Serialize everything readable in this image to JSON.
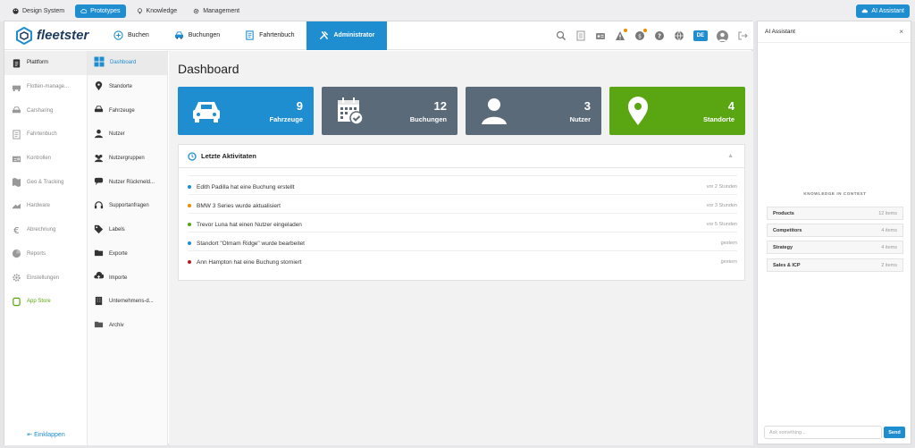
{
  "topbar": {
    "tabs": [
      {
        "label": "Design System",
        "icon": "palette-icon"
      },
      {
        "label": "Prototypes",
        "icon": "cloud-icon"
      },
      {
        "label": "Knowledge",
        "icon": "bulb-icon"
      },
      {
        "label": "Management",
        "icon": "gear-icon"
      }
    ],
    "ai_button": "AI Assistant"
  },
  "header": {
    "logo": "fleetster",
    "nav": [
      {
        "label": "Buchen",
        "icon": "plus-circle-icon"
      },
      {
        "label": "Buchungen",
        "icon": "car-icon"
      },
      {
        "label": "Fahrtenbuch",
        "icon": "logbook-icon"
      },
      {
        "label": "Administrator",
        "icon": "tools-icon"
      }
    ],
    "lang": "DE"
  },
  "sidebar": {
    "items": [
      {
        "label": "Plattform",
        "icon": "clipboard-icon"
      },
      {
        "label": "Flotten-manage...",
        "icon": "fleet-icon"
      },
      {
        "label": "Carsharing",
        "icon": "carsharing-icon"
      },
      {
        "label": "Fahrtenbuch",
        "icon": "logbook-icon"
      },
      {
        "label": "Kontrollen",
        "icon": "check-card-icon"
      },
      {
        "label": "Geo & Tracking",
        "icon": "map-icon"
      },
      {
        "label": "Hardware",
        "icon": "hardware-icon"
      },
      {
        "label": "Abrechnung",
        "icon": "euro-icon"
      },
      {
        "label": "Reports",
        "icon": "chart-pie-icon"
      },
      {
        "label": "Einstellungen",
        "icon": "settings-icon"
      },
      {
        "label": "App Store",
        "icon": "app-store-icon"
      }
    ],
    "collapse_label": "Einklappen"
  },
  "subnav": {
    "items": [
      {
        "label": "Dashboard",
        "icon": "dashboard-icon"
      },
      {
        "label": "Standorte",
        "icon": "pin-icon"
      },
      {
        "label": "Fahrzeuge",
        "icon": "car-icon"
      },
      {
        "label": "Nutzer",
        "icon": "user-icon"
      },
      {
        "label": "Nutzergruppen",
        "icon": "users-icon"
      },
      {
        "label": "Nutzer Rückmeld...",
        "icon": "feedback-icon"
      },
      {
        "label": "Supportanfragen",
        "icon": "headset-icon"
      },
      {
        "label": "Labels",
        "icon": "tag-icon"
      },
      {
        "label": "Exporte",
        "icon": "folder-icon"
      },
      {
        "label": "Importe",
        "icon": "upload-icon"
      },
      {
        "label": "Unternehmens-d...",
        "icon": "building-icon"
      },
      {
        "label": "Archiv",
        "icon": "archive-icon"
      }
    ]
  },
  "main": {
    "title": "Dashboard",
    "cards": [
      {
        "value": "9",
        "label": "Fahrzeuge",
        "color": "#1e8ed1",
        "icon": "car-icon"
      },
      {
        "value": "12",
        "label": "Buchungen",
        "color": "#5b6a78",
        "icon": "calendar-check-icon"
      },
      {
        "value": "3",
        "label": "Nutzer",
        "color": "#5b6a78",
        "icon": "user-icon"
      },
      {
        "value": "4",
        "label": "Standorte",
        "color": "#5aa612",
        "icon": "pin-icon"
      }
    ],
    "activity": {
      "title": "Letzte Aktivitaten",
      "items": [
        {
          "text": "Edith Padilla hat eine Buchung erstellt",
          "time": "vor 2 Stunden",
          "color": "#1e8ed1"
        },
        {
          "text": "BMW 3 Series wurde aktualisiert",
          "time": "vor 3 Stunden",
          "color": "#f08a00"
        },
        {
          "text": "Trevor Luna hat einen Nutzer eingeladen",
          "time": "vor 5 Stunden",
          "color": "#5aa612"
        },
        {
          "text": "Standort \"Olmam Ridge\" wurde bearbeitet",
          "time": "gestern",
          "color": "#1e8ed1"
        },
        {
          "text": "Ann Hampton hat eine Buchung storniert",
          "time": "gestern",
          "color": "#b02020"
        }
      ]
    }
  },
  "ai": {
    "title": "AI Assistant",
    "knowledge_heading": "KNOWLEDGE IN CONTEXT",
    "knowledge": [
      {
        "label": "Products",
        "count": "12 items"
      },
      {
        "label": "Competitors",
        "count": "4 items"
      },
      {
        "label": "Strategy",
        "count": "4 items"
      },
      {
        "label": "Sales & ICP",
        "count": "2 items"
      }
    ],
    "input_placeholder": "Ask something...",
    "send": "Send"
  }
}
